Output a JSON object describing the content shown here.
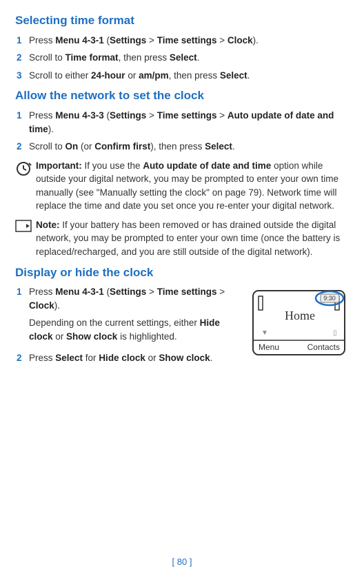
{
  "sections": {
    "timeFormat": {
      "heading": "Selecting time format",
      "steps": [
        {
          "num": "1",
          "text_pre": "Press ",
          "bold1": "Menu 4-3-1",
          "text_mid1": " (",
          "bold2": "Settings",
          "text_mid2": " > ",
          "bold3": "Time settings",
          "text_mid3": " > ",
          "bold4": "Clock",
          "text_post": ")."
        },
        {
          "num": "2",
          "text_pre": "Scroll to ",
          "bold1": "Time format",
          "text_mid1": ", then press ",
          "bold2": "Select",
          "text_post": "."
        },
        {
          "num": "3",
          "text_pre": "Scroll to either ",
          "bold1": "24-hour",
          "text_mid1": " or ",
          "bold2": "am/pm",
          "text_mid2": ", then press ",
          "bold3": "Select",
          "text_post": "."
        }
      ]
    },
    "networkClock": {
      "heading": "Allow the network to set the clock",
      "steps": [
        {
          "num": "1",
          "text_pre": "Press ",
          "bold1": "Menu 4-3-3",
          "text_mid1": " (",
          "bold2": "Settings",
          "text_mid2": " > ",
          "bold3": "Time settings",
          "text_mid3": " > ",
          "bold4": "Auto update of date and time",
          "text_post": ")."
        },
        {
          "num": "2",
          "text_pre": "Scroll to ",
          "bold1": "On",
          "text_mid1": " (or ",
          "bold2": "Confirm first",
          "text_mid2": "), then press ",
          "bold3": "Select",
          "text_post": "."
        }
      ],
      "important": {
        "label": "Important:",
        "text_pre": " If you use the ",
        "bold1": "Auto update of date and time",
        "text_post": " option while outside your digital network, you may be prompted to enter your own time manually (see \"Manually setting the clock\" on page 79). Network time will replace the time and date you set once you re-enter your digital network."
      },
      "note": {
        "label": "Note:",
        "text": " If your battery has been removed or has drained outside the digital network, you may be prompted to enter your own time (once the battery is replaced/recharged, and you are still outside of the digital network)."
      }
    },
    "displayHide": {
      "heading": "Display or hide the clock",
      "steps": [
        {
          "num": "1",
          "text_pre": "Press ",
          "bold1": "Menu 4-3-1",
          "text_mid1": " (",
          "bold2": "Settings",
          "text_mid2": " > ",
          "bold3": "Time settings",
          "text_mid3": " > ",
          "bold4": "Clock",
          "text_post": ").",
          "extra_pre": "Depending on the current settings, either ",
          "extra_bold1": "Hide clock",
          "extra_mid1": " or ",
          "extra_bold2": "Show clock",
          "extra_post": " is highlighted."
        },
        {
          "num": "2",
          "text_pre": "Press ",
          "bold1": "Select",
          "text_mid1": " for ",
          "bold2": "Hide clock",
          "text_mid2": " or ",
          "bold3": "Show clock",
          "text_post": "."
        }
      ]
    }
  },
  "phone": {
    "title": "Home",
    "time": "9:30",
    "leftSoft": "Menu",
    "rightSoft": "Contacts"
  },
  "pageNumber": "[ 80 ]"
}
